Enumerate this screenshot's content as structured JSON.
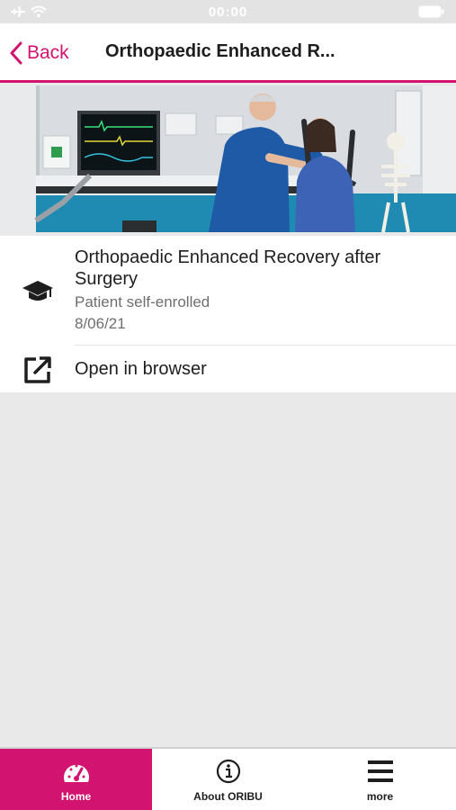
{
  "status_bar": {
    "time": "00:00"
  },
  "nav": {
    "back_label": "Back",
    "title": "Orthopaedic Enhanced R..."
  },
  "course": {
    "title": "Orthopaedic Enhanced Recovery after Surgery",
    "status": "Patient self-enrolled",
    "date": "8/06/21",
    "icon": "graduation-cap-icon"
  },
  "actions": {
    "open_browser_label": "Open in browser",
    "open_browser_icon": "external-link-icon"
  },
  "tabs": [
    {
      "label": "Home",
      "icon": "dashboard-gauge-icon",
      "active": true
    },
    {
      "label": "About ORIBU",
      "icon": "info-circle-icon",
      "active": false
    },
    {
      "label": "more",
      "icon": "hamburger-menu-icon",
      "active": false
    }
  ],
  "colors": {
    "accent": "#d2136f",
    "background": "#e9e9e9",
    "card": "#ffffff",
    "text": "#1e1e1e",
    "secondary_text": "#6e6e6e"
  }
}
